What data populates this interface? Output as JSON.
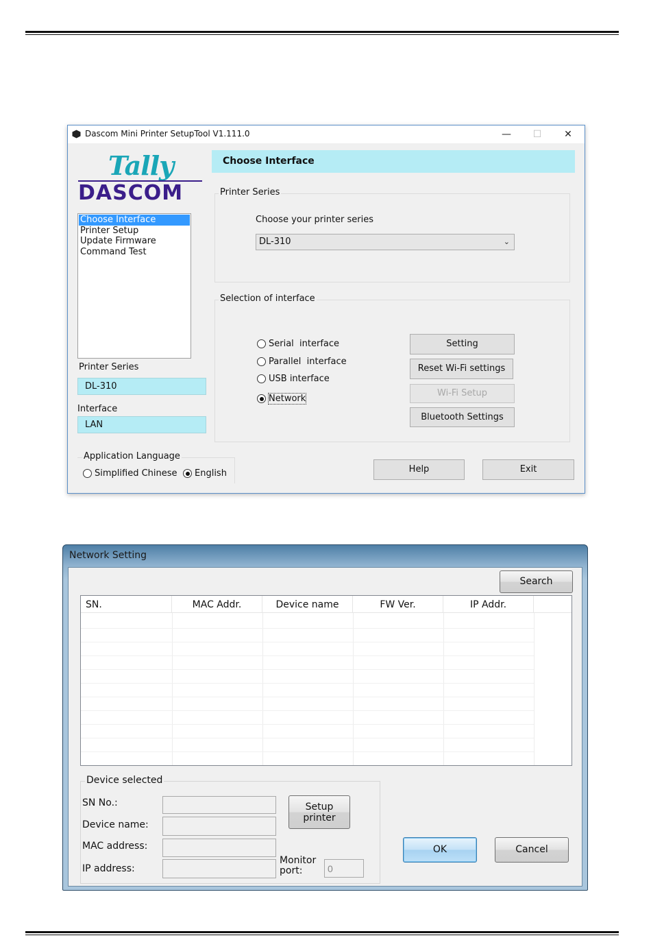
{
  "window1": {
    "title": "Dascom Mini Printer SetupTool V1.111.0",
    "controls": {
      "minimize": "—",
      "maximize": "☐",
      "close": "✕"
    },
    "logo": {
      "top": "Tally",
      "bottom": "DASCOM"
    },
    "nav_items": [
      "Choose Interface",
      "Printer Setup",
      "Update Firmware",
      "Command Test"
    ],
    "selected_nav": 0,
    "side": {
      "printer_series_label": "Printer Series",
      "printer_series_value": "DL-310",
      "interface_label": "Interface",
      "interface_value": "LAN"
    },
    "header": "Choose Interface",
    "printer_series_group": {
      "label": "Printer Series",
      "prompt": "Choose your printer series",
      "selected": "DL-310"
    },
    "interface_group": {
      "label": "Selection of interface",
      "options": [
        "Serial  interface",
        "Parallel  interface",
        "USB interface",
        "Network"
      ],
      "selected": 3,
      "buttons": {
        "setting": "Setting",
        "reset_wifi": "Reset Wi-Fi settings",
        "wifi_setup": "Wi-Fi Setup",
        "bluetooth": "Bluetooth Settings"
      }
    },
    "language": {
      "label": "Application Language",
      "options": [
        "Simplified Chinese",
        "English"
      ],
      "selected": 1
    },
    "help_label": "Help",
    "exit_label": "Exit"
  },
  "window2": {
    "title": "Network Setting",
    "search_label": "Search",
    "columns": [
      "SN.",
      "MAC Addr.",
      "Device name",
      "FW Ver.",
      "IP Addr."
    ],
    "rows": [],
    "device_selected": {
      "label": "Device selected",
      "sn_label": "SN No.:",
      "sn_value": "",
      "device_name_label": "Device name:",
      "device_name_value": "",
      "mac_label": "MAC address:",
      "mac_value": "",
      "ip_label": "IP address:",
      "ip_value": "",
      "monitor_port_label_1": "Monitor",
      "monitor_port_label_2": "port:",
      "monitor_port_value": "0",
      "setup_label_1": "Setup",
      "setup_label_2": "printer"
    },
    "ok_label": "OK",
    "cancel_label": "Cancel"
  }
}
